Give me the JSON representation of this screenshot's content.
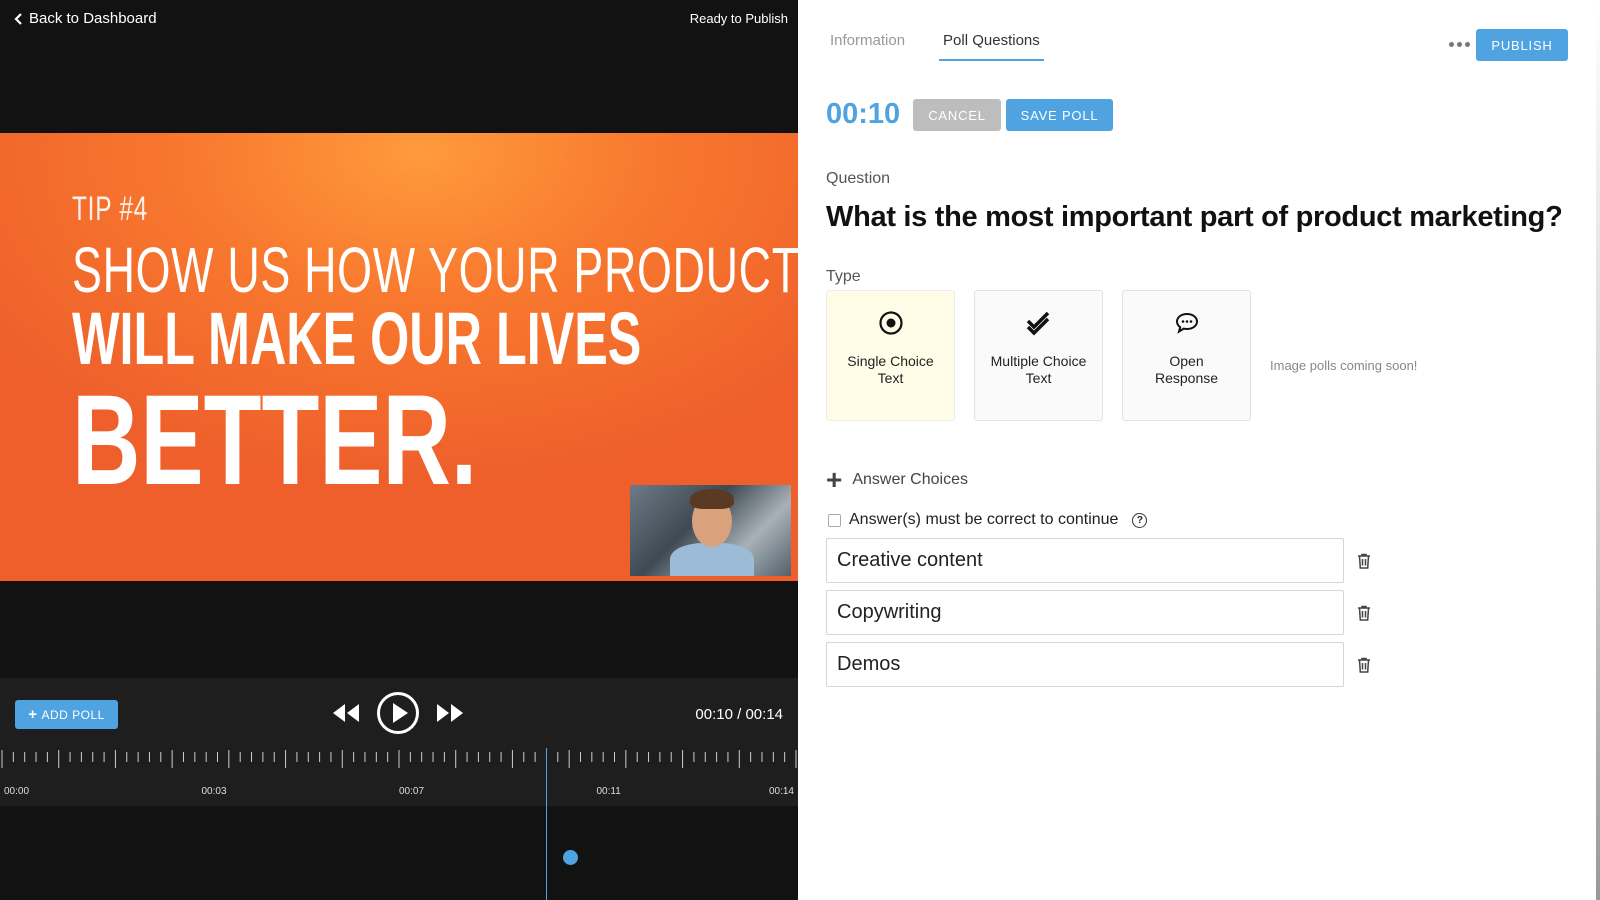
{
  "topbar": {
    "back_label": "Back to Dashboard",
    "status": "Ready to Publish"
  },
  "slide": {
    "tip": "TIP #4",
    "line1": "SHOW US HOW YOUR PRODUCT",
    "line2": "WILL MAKE OUR LIVES",
    "line3": "BETTER."
  },
  "player": {
    "add_poll_label": "ADD POLL",
    "current_time": "00:10",
    "total_time": "00:14",
    "time_display": "00:10 / 00:14",
    "timeline_labels": [
      "00:00",
      "00:03",
      "00:07",
      "00:11",
      "00:14"
    ],
    "playhead_seconds": 10,
    "poll_marker_seconds": 10.5
  },
  "tabs": [
    {
      "label": "Information",
      "active": false
    },
    {
      "label": "Poll Questions",
      "active": true
    }
  ],
  "header": {
    "more_icon": "ellipsis-icon",
    "publish_label": "PUBLISH"
  },
  "poll": {
    "time": "00:10",
    "cancel_label": "CANCEL",
    "save_label": "SAVE POLL",
    "question_label": "Question",
    "question": "What is the most important part of product marketing?",
    "type_label": "Type",
    "types": [
      {
        "label": "Single Choice Text",
        "icon": "radio-icon",
        "selected": true
      },
      {
        "label": "Multiple Choice Text",
        "icon": "double-check-icon",
        "selected": false
      },
      {
        "label": "Open Response",
        "icon": "speech-bubble-icon",
        "selected": false
      }
    ],
    "image_note": "Image polls coming soon!",
    "answer_choices_label": "Answer Choices",
    "must_be_correct_label": "Answer(s) must be correct to continue",
    "must_be_correct_checked": false,
    "answers": [
      "Creative content",
      "Copywriting",
      "Demos"
    ]
  },
  "colors": {
    "accent": "#4fa3e0",
    "slide_orange": "#f8782e",
    "cancel_gray": "#bdbdbd",
    "selected_card": "#fffde8"
  }
}
